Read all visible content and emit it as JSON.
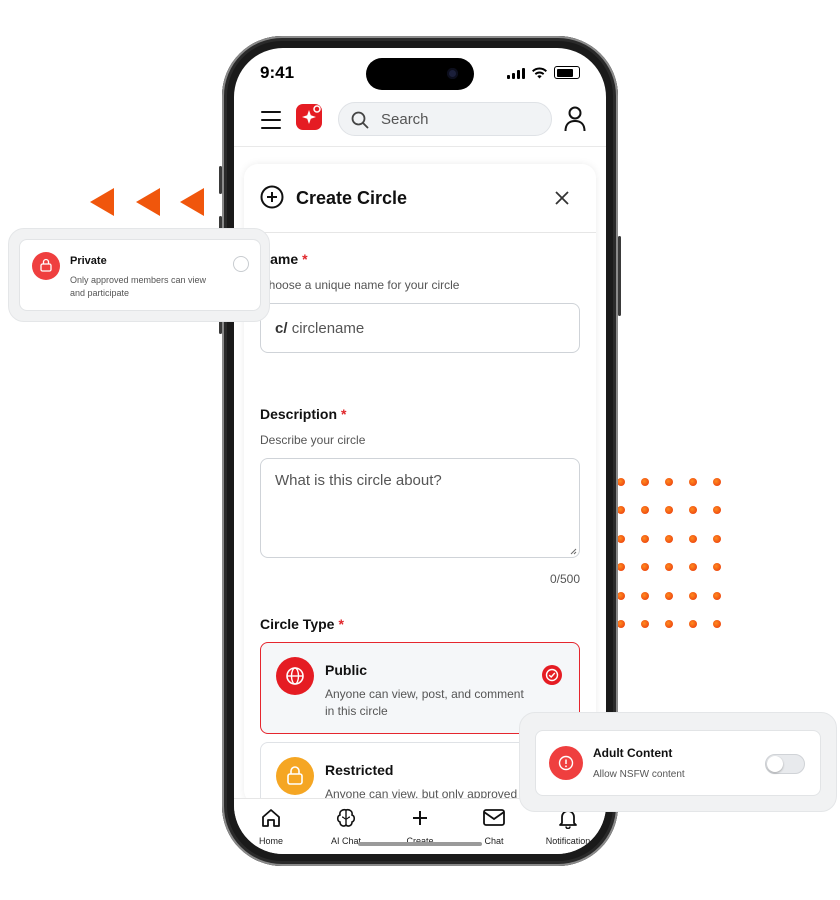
{
  "status_bar": {
    "time": "9:41"
  },
  "header": {
    "search_placeholder": "Search"
  },
  "modal": {
    "title": "Create Circle"
  },
  "name_field": {
    "label": "Name",
    "required_mark": "*",
    "help": "Choose a unique name for your circle",
    "prefix": "c/",
    "placeholder": "circlename"
  },
  "description_field": {
    "label": "Description",
    "required_mark": "*",
    "help": "Describe your circle",
    "placeholder": "What is this circle about?",
    "counter": "0/500"
  },
  "circle_type": {
    "label": "Circle Type",
    "required_mark": "*",
    "options": [
      {
        "title": "Public",
        "description": "Anyone can view, post, and comment in this circle",
        "selected": true,
        "icon": "globe-icon"
      },
      {
        "title": "Restricted",
        "description": "Anyone can view, but only approved",
        "selected": false,
        "icon": "lock-icon"
      }
    ]
  },
  "bottom_nav": [
    {
      "label": "Home",
      "icon": "home-icon"
    },
    {
      "label": "AI Chat",
      "icon": "brain-icon"
    },
    {
      "label": "Create",
      "icon": "plus-icon"
    },
    {
      "label": "Chat",
      "icon": "mail-icon"
    },
    {
      "label": "Notification",
      "icon": "bell-icon"
    }
  ],
  "private_card": {
    "title": "Private",
    "description": "Only approved members can view and participate",
    "icon": "lock-icon",
    "selected": false
  },
  "adult_card": {
    "title": "Adult Content",
    "description": "Allow NSFW content",
    "icon": "alert-icon",
    "enabled": false
  },
  "colors": {
    "accent": "#e51c23",
    "decor_orange": "#f0560c",
    "restricted_orange": "#f5a623"
  }
}
